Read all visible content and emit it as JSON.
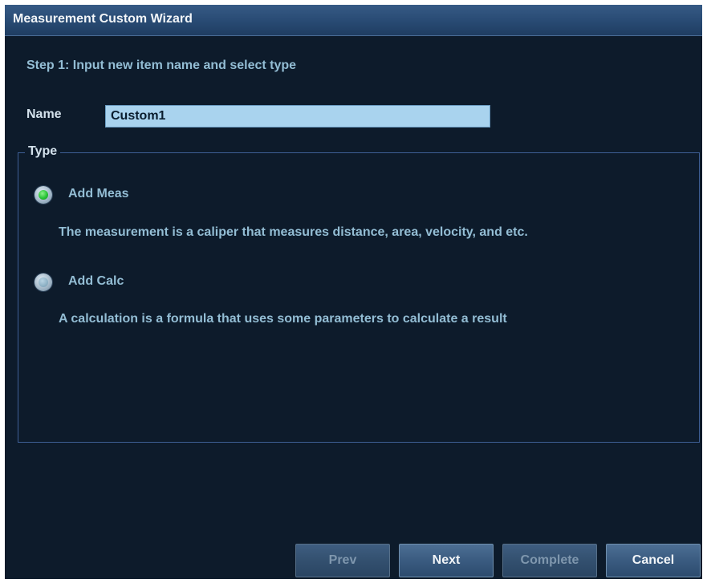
{
  "window": {
    "title": "Measurement Custom Wizard"
  },
  "step": {
    "text": "Step 1: Input new item name and select type"
  },
  "name_field": {
    "label": "Name",
    "value": "Custom1"
  },
  "type_group": {
    "legend": "Type",
    "options": [
      {
        "label": "Add Meas",
        "selected": true,
        "description": "The measurement is a caliper that measures distance, area, velocity, and etc."
      },
      {
        "label": "Add Calc",
        "selected": false,
        "description": "A calculation is a formula that uses some parameters to calculate a result"
      }
    ]
  },
  "buttons": {
    "prev": {
      "label": "Prev",
      "enabled": false
    },
    "next": {
      "label": "Next",
      "enabled": true
    },
    "complete": {
      "label": "Complete",
      "enabled": false
    },
    "cancel": {
      "label": "Cancel",
      "enabled": true
    }
  },
  "colors": {
    "background": "#0d1b2b",
    "titlebar": "#284a73",
    "accent_text": "#93bdd4",
    "input_bg": "#a9d3ee",
    "selected_radio": "#28c436",
    "group_border": "#3e5f95"
  }
}
